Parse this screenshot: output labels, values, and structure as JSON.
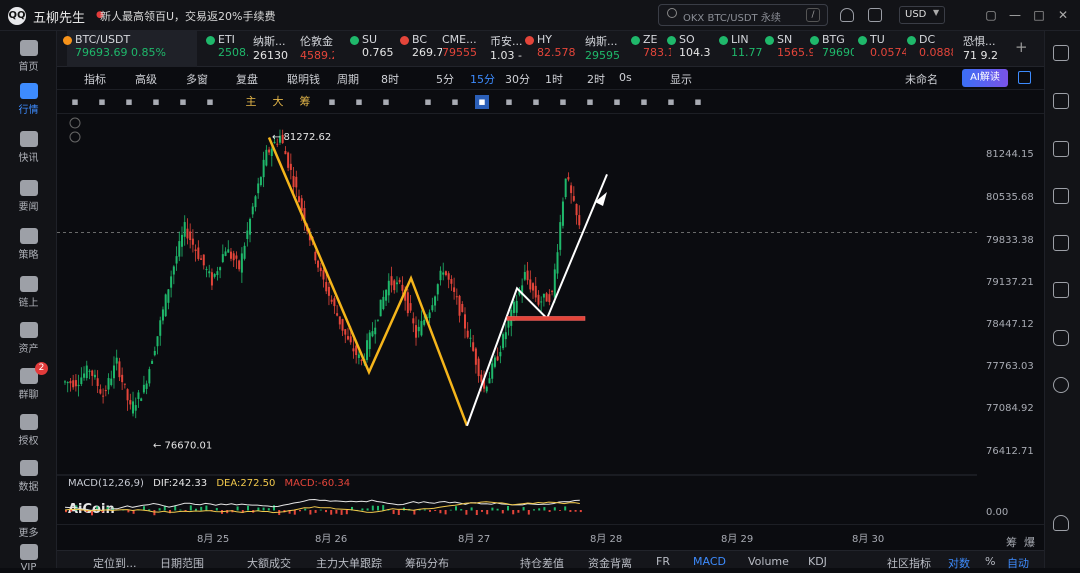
{
  "app": {
    "name": "五柳先生",
    "logo": "QQ",
    "notice": "新人最高领百U，交易返20%手续费",
    "search_placeholder": "OKX BTC/USDT 永续",
    "search_shortcut": "/",
    "currency": "USD"
  },
  "leftnav": [
    {
      "label": "首页",
      "icon": "home-icon"
    },
    {
      "label": "行情",
      "icon": "market-icon",
      "active": true
    },
    {
      "label": "快讯",
      "icon": "flash-news-icon"
    },
    {
      "label": "要闻",
      "icon": "news-icon"
    },
    {
      "label": "策略",
      "icon": "strategy-icon"
    },
    {
      "label": "链上",
      "icon": "onchain-icon"
    },
    {
      "label": "资产",
      "icon": "wallet-icon"
    },
    {
      "label": "群聊",
      "icon": "chat-icon",
      "badge": "2"
    },
    {
      "label": "授权",
      "icon": "authorize-icon"
    },
    {
      "label": "数据",
      "icon": "data-icon"
    },
    {
      "label": "更多",
      "icon": "more-icon"
    },
    {
      "label": "VIP",
      "icon": "vip-icon"
    }
  ],
  "tickers": [
    {
      "name": "BTC/USDT",
      "value": "79693.69 0.85%",
      "dir": "up",
      "dot": "#f7931a"
    },
    {
      "name": "ETI",
      "value": "2508.0",
      "dir": "up",
      "dot": "#1fb86b"
    },
    {
      "name": "纳斯...",
      "value": "26130",
      "dir": "wh",
      "dot": ""
    },
    {
      "name": "伦敦金",
      "value": "4589.2",
      "dir": "dn",
      "dot": ""
    },
    {
      "name": "SU",
      "value": "0.765",
      "dir": "wh",
      "dot": "#1fb86b"
    },
    {
      "name": "BC",
      "value": "269.7",
      "dir": "wh",
      "dot": "#e4453a"
    },
    {
      "name": "CME...",
      "value": "79555",
      "dir": "dn",
      "dot": ""
    },
    {
      "name": "币安...",
      "value": "1.03 -",
      "dir": "wh",
      "dot": ""
    },
    {
      "name": "HY",
      "value": "82.578",
      "dir": "dn",
      "dot": "#e4453a"
    },
    {
      "name": "纳斯...",
      "value": "29595",
      "dir": "up",
      "dot": ""
    },
    {
      "name": "ZE",
      "value": "783.1",
      "dir": "dn",
      "dot": "#1fb86b"
    },
    {
      "name": "SO",
      "value": "104.3",
      "dir": "wh",
      "dot": "#1fb86b"
    },
    {
      "name": "LIN",
      "value": "11.77",
      "dir": "up",
      "dot": "#1fb86b"
    },
    {
      "name": "SN",
      "value": "1565.9",
      "dir": "dn",
      "dot": "#1fb86b"
    },
    {
      "name": "BTG",
      "value": "79690",
      "dir": "up",
      "dot": "#1fb86b"
    },
    {
      "name": "TU",
      "value": "0.0574",
      "dir": "dn",
      "dot": "#1fb86b"
    },
    {
      "name": "DC",
      "value": "0.0888",
      "dir": "dn",
      "dot": "#1fb86b"
    },
    {
      "name": "恐惧...",
      "value": "71 9.2",
      "dir": "wh",
      "dot": ""
    }
  ],
  "toolbar1": {
    "items": [
      "指标",
      "高级",
      "多窗",
      "复盘",
      "聪明钱",
      "周期",
      "8时",
      "5分",
      "15分",
      "30分",
      "1时",
      "2时",
      "0s",
      "显示",
      "未命名"
    ],
    "selected": "15分",
    "ai_button": "AI解读"
  },
  "drawing_tools": [
    "line-tool-icon",
    "hline-tool-icon",
    "channel-tool-icon",
    "fib-tool-icon",
    "rect-tool-icon",
    "brush-tool-icon",
    "主",
    "大",
    "筹",
    "indicator-a-icon",
    "indicator-b-icon",
    "magnet-icon",
    "ruler-icon",
    "zoom-icon",
    "pen-icon",
    "pattern-icon",
    "lock-icon",
    "screenshot-icon",
    "eye-icon",
    "filter-icon",
    "delete-icon",
    "undo-icon",
    "redo-icon"
  ],
  "chart": {
    "title": "BTC/USDT 15分",
    "high_label": "81272.62",
    "low_label": "76670.01",
    "price_line": 79833.38,
    "yticks": [
      "81244.15",
      "80535.68",
      "79833.38",
      "79137.21",
      "78447.12",
      "77763.03",
      "77084.92",
      "76412.71",
      "0.00"
    ],
    "xticks": [
      "8月 25",
      "8月 26",
      "8月 27",
      "8月 28",
      "8月 29",
      "8月 30"
    ],
    "yrange": [
      76200,
      81600
    ],
    "axis_unit": "USDT",
    "corner_labels": [
      "筹",
      "爆"
    ]
  },
  "chart_data": {
    "type": "candlestick",
    "title": "",
    "xlabel": "",
    "ylabel": "",
    "x": [
      "8月 25",
      "8月 26",
      "8月 27",
      "8月 28",
      "8月 29",
      "8月 30"
    ],
    "series": [
      {
        "name": "",
        "close": [
          77600,
          77800,
          77400,
          77900,
          77200,
          77500,
          78300,
          79200,
          79900,
          79500,
          79100,
          79600,
          79300,
          80200,
          81000,
          81272,
          80600,
          79900,
          79200,
          78700,
          78200,
          77900,
          78500,
          79100,
          79000,
          78300,
          78700,
          79300,
          78800,
          78200,
          77500,
          78000,
          78600,
          79200,
          78800,
          78900,
          80700,
          79900
        ]
      }
    ],
    "annotations": [
      {
        "text": "81272.62",
        "type": "high"
      },
      {
        "text": "76670.01",
        "type": "low"
      }
    ],
    "ylim": [
      76200,
      81600
    ],
    "grid": false
  },
  "macd": {
    "label": "MACD(12,26,9)",
    "dif": "DIF:242.33",
    "dea": "DEA:272.50",
    "macd": "MACD:-60.34",
    "watermark": "AiCoin"
  },
  "bottombar": {
    "items": [
      "定位到...",
      "日期范围",
      "大额成交",
      "主力大单跟踪",
      "筹码分布",
      "持仓差值",
      "资金背离",
      "FR",
      "MACD",
      "Volume",
      "KDJ",
      "社区指标",
      "对数",
      "%",
      "自动"
    ],
    "selected": [
      "MACD",
      "对数",
      "自动"
    ]
  }
}
